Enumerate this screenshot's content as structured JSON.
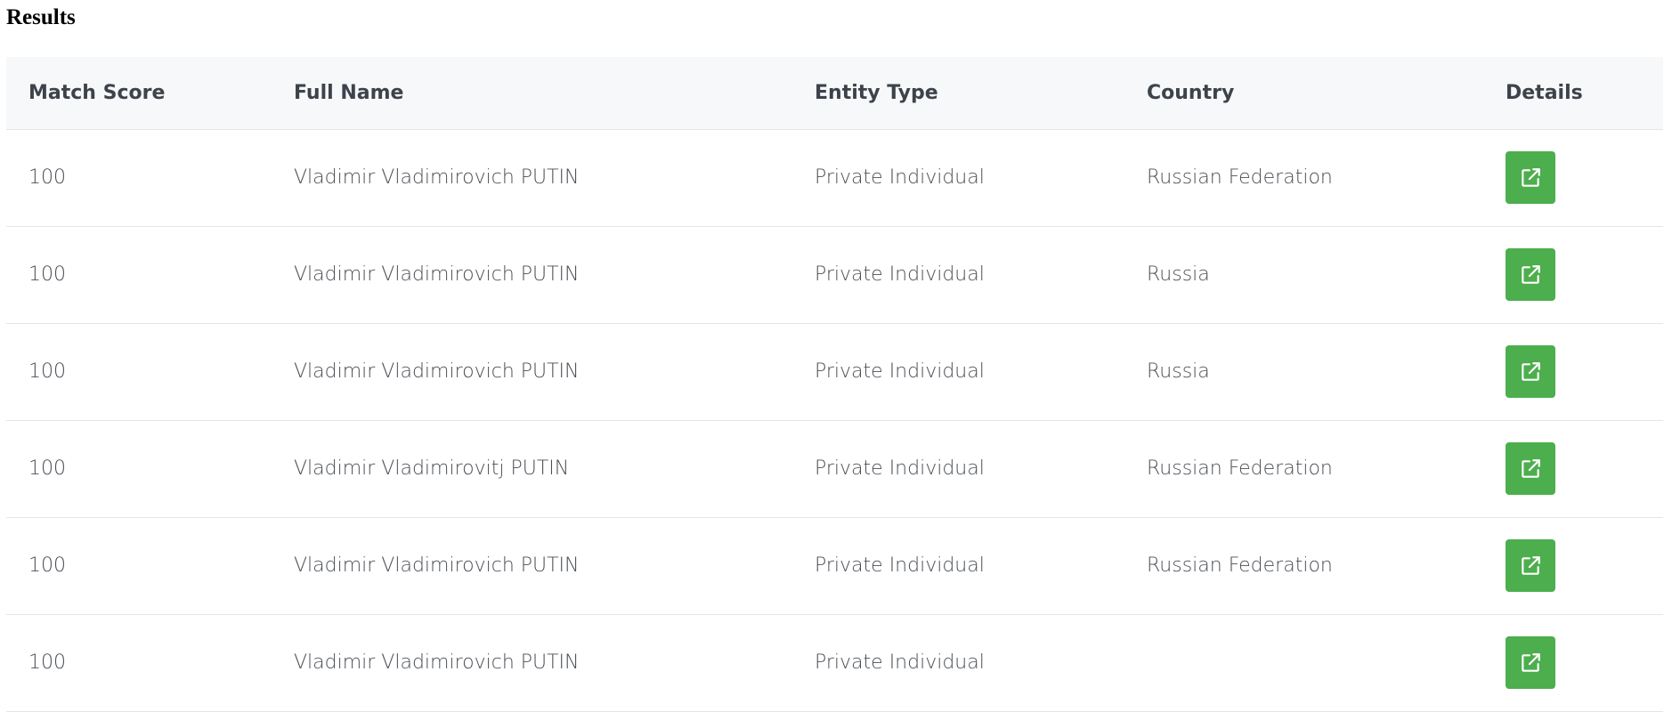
{
  "page": {
    "title": "Results"
  },
  "table": {
    "headers": {
      "match_score": "Match Score",
      "full_name": "Full Name",
      "entity_type": "Entity Type",
      "country": "Country",
      "details": "Details"
    },
    "rows": [
      {
        "match_score": "100",
        "full_name": "Vladimir Vladimirovich PUTIN",
        "entity_type": "Private Individual",
        "country": "Russian Federation"
      },
      {
        "match_score": "100",
        "full_name": "Vladimir Vladimirovich PUTIN",
        "entity_type": "Private Individual",
        "country": "Russia"
      },
      {
        "match_score": "100",
        "full_name": "Vladimir Vladimirovich PUTIN",
        "entity_type": "Private Individual",
        "country": "Russia"
      },
      {
        "match_score": "100",
        "full_name": "Vladimir Vladimirovitj PUTIN",
        "entity_type": "Private Individual",
        "country": "Russian Federation"
      },
      {
        "match_score": "100",
        "full_name": "Vladimir Vladimirovich PUTIN",
        "entity_type": "Private Individual",
        "country": "Russian Federation"
      },
      {
        "match_score": "100",
        "full_name": "Vladimir Vladimirovich PUTIN",
        "entity_type": "Private Individual",
        "country": ""
      }
    ],
    "details_icon": "external-link-icon"
  },
  "colors": {
    "details_button": "#4cae4c",
    "header_background": "#f7f8fa",
    "row_divider": "#e3e6ea",
    "text": "#4a4f55"
  }
}
